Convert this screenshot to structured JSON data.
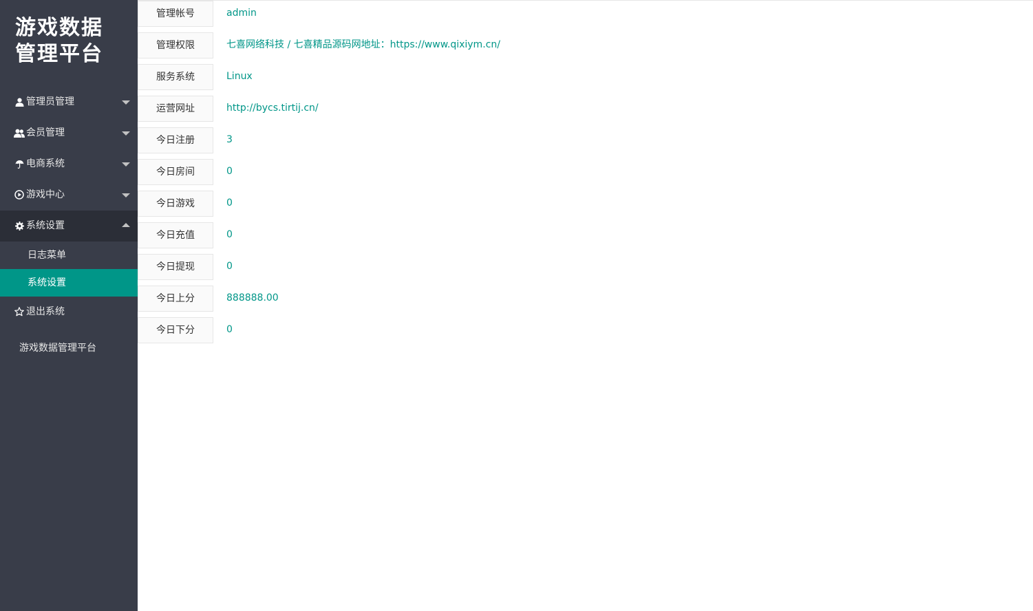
{
  "sidebar": {
    "logo_line1": "游戏数据",
    "logo_line2": "管理平台",
    "nav": [
      {
        "label": "管理员管理",
        "icon": "user-icon"
      },
      {
        "label": "会员管理",
        "icon": "users-icon"
      },
      {
        "label": "电商系统",
        "icon": "umbrella-icon"
      },
      {
        "label": "游戏中心",
        "icon": "play-circle-icon"
      },
      {
        "label": "系统设置",
        "icon": "gear-icon"
      },
      {
        "label": "退出系统",
        "icon": "star-outline-icon"
      }
    ],
    "submenu": [
      {
        "label": "日志菜单"
      },
      {
        "label": "系统设置"
      }
    ],
    "footer": "游戏数据管理平台"
  },
  "info": [
    {
      "label": "管理帐号",
      "value": "admin"
    },
    {
      "label": "管理权限",
      "value": "七喜网络科技 / 七喜精品源码网地址：https://www.qixiym.cn/"
    },
    {
      "label": "服务系统",
      "value": "Linux"
    },
    {
      "label": "运营网址",
      "value": "http://bycs.tirtij.cn/"
    },
    {
      "label": "今日注册",
      "value": "3"
    },
    {
      "label": "今日房间",
      "value": "0"
    },
    {
      "label": "今日游戏",
      "value": "0"
    },
    {
      "label": "今日充值",
      "value": "0"
    },
    {
      "label": "今日提现",
      "value": "0"
    },
    {
      "label": "今日上分",
      "value": "888888.00"
    },
    {
      "label": "今日下分",
      "value": "0"
    }
  ],
  "colors": {
    "sidebar_bg": "#393d49",
    "accent": "#009688",
    "open_item_bg": "#2b2e37"
  }
}
